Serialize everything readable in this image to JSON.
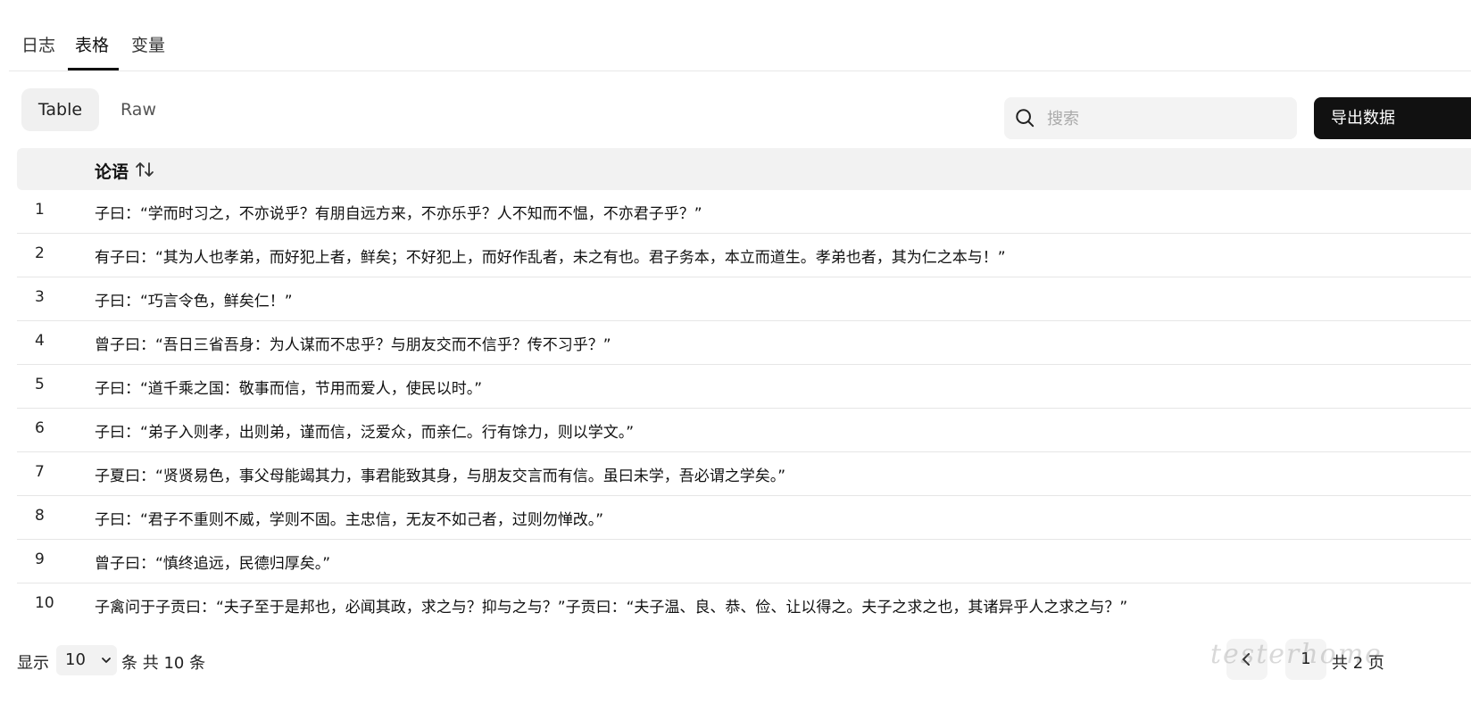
{
  "top_tabs": [
    {
      "label": "日志",
      "active": false
    },
    {
      "label": "表格",
      "active": true
    },
    {
      "label": "变量",
      "active": false
    }
  ],
  "view_toggle": {
    "table_label": "Table",
    "raw_label": "Raw",
    "selected": "Table"
  },
  "search": {
    "placeholder": "搜索",
    "value": "",
    "icon": "search-icon"
  },
  "export_button": {
    "label": "导出数据"
  },
  "table": {
    "column_header": "论语",
    "sort_icon": "sort-icon",
    "rows": [
      {
        "index": "1",
        "text": "子曰：“学而时习之，不亦说乎？有朋自远方来，不亦乐乎？人不知而不愠，不亦君子乎？”"
      },
      {
        "index": "2",
        "text": "有子曰：“其为人也孝弟，而好犯上者，鲜矣；不好犯上，而好作乱者，未之有也。君子务本，本立而道生。孝弟也者，其为仁之本与！”"
      },
      {
        "index": "3",
        "text": "子曰：“巧言令色，鲜矣仁！”"
      },
      {
        "index": "4",
        "text": "曾子曰：“吾日三省吾身：为人谋而不忠乎？与朋友交而不信乎？传不习乎？”"
      },
      {
        "index": "5",
        "text": "子曰：“道千乘之国：敬事而信，节用而爱人，使民以时。”"
      },
      {
        "index": "6",
        "text": "子曰：“弟子入则孝，出则弟，谨而信，泛爱众，而亲仁。行有馀力，则以学文。”"
      },
      {
        "index": "7",
        "text": "子夏曰：“贤贤易色，事父母能竭其力，事君能致其身，与朋友交言而有信。虽曰未学，吾必谓之学矣。”"
      },
      {
        "index": "8",
        "text": "子曰：“君子不重则不威，学则不固。主忠信，无友不如己者，过则勿惮改。”"
      },
      {
        "index": "9",
        "text": "曾子曰：“慎终追远，民德归厚矣。”"
      },
      {
        "index": "10",
        "text": "子禽问于子贡曰：“夫子至于是邦也，必闻其政，求之与？抑与之与？”子贡曰：“夫子温、良、恭、俭、让以得之。夫子之求之也，其诸异乎人之求之与？”"
      }
    ]
  },
  "footer": {
    "show_label": "显示",
    "page_size": "10",
    "total_label": "条 共 10 条",
    "current_page": "1",
    "pages_label": "共 2 页",
    "watermark": "testerhome"
  }
}
